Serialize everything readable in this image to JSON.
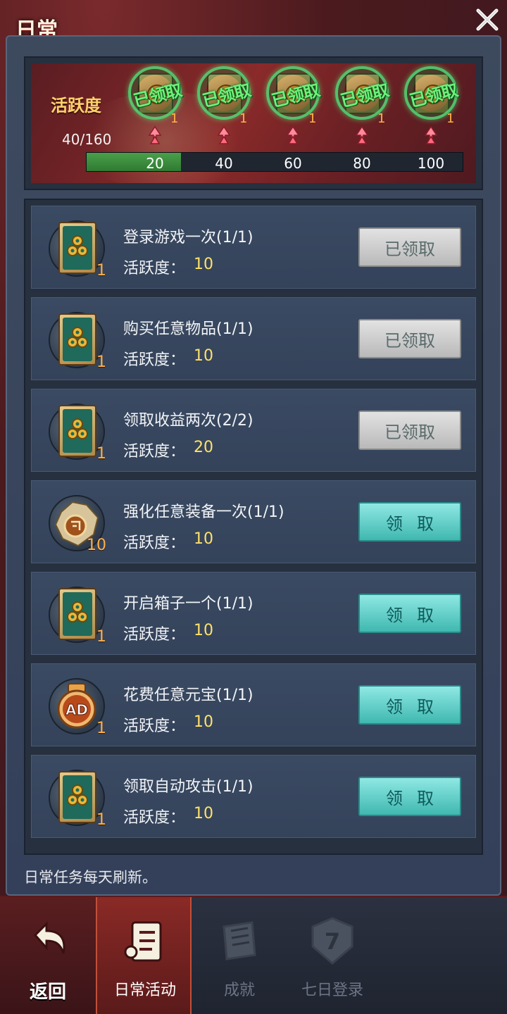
{
  "header": {
    "title": "日常"
  },
  "activity": {
    "label": "活跃度",
    "count_text": "40/160",
    "progress_fraction": 0.25,
    "stamp_text": "已领取",
    "milestones": [
      {
        "value": "20",
        "qty": "1"
      },
      {
        "value": "40",
        "qty": "1"
      },
      {
        "value": "60",
        "qty": "1"
      },
      {
        "value": "80",
        "qty": "1"
      },
      {
        "value": "100",
        "qty": "1"
      }
    ]
  },
  "tasks": [
    {
      "title": "登录游戏一次(1/1)",
      "points_label": "活跃度：",
      "points": "10",
      "qty": "1",
      "icon": "talisman-icon",
      "button": "已领取",
      "state": "claimed"
    },
    {
      "title": "购买任意物品(1/1)",
      "points_label": "活跃度：",
      "points": "10",
      "qty": "1",
      "icon": "talisman-icon",
      "button": "已领取",
      "state": "claimed"
    },
    {
      "title": "领取收益两次(2/2)",
      "points_label": "活跃度：",
      "points": "20",
      "qty": "1",
      "icon": "talisman-icon",
      "button": "已领取",
      "state": "claimed"
    },
    {
      "title": "强化任意装备一次(1/1)",
      "points_label": "活跃度：",
      "points": "10",
      "qty": "10",
      "icon": "enhance-stone-icon",
      "button": "领取",
      "state": "claim"
    },
    {
      "title": "开启箱子一个(1/1)",
      "points_label": "活跃度：",
      "points": "10",
      "qty": "1",
      "icon": "talisman-icon",
      "button": "领取",
      "state": "claim"
    },
    {
      "title": "花费任意元宝(1/1)",
      "points_label": "活跃度：",
      "points": "10",
      "qty": "1",
      "icon": "ad-badge-icon",
      "button": "领取",
      "state": "claim"
    },
    {
      "title": "领取自动攻击(1/1)",
      "points_label": "活跃度：",
      "points": "10",
      "qty": "1",
      "icon": "talisman-icon",
      "button": "领取",
      "state": "claim"
    }
  ],
  "footer_note": "日常任务每天刷新。",
  "nav": {
    "back": "返回",
    "daily": "日常活动",
    "achievements": "成就",
    "seven_day": "七日登录",
    "seven_day_badge": "7"
  },
  "colors": {
    "claim_button": "#3fb8b0",
    "claimed_button": "#b9b9b9",
    "points_value": "#ffe06a",
    "progress_fill": "#2f7a32",
    "stamp": "#6cf27a"
  }
}
